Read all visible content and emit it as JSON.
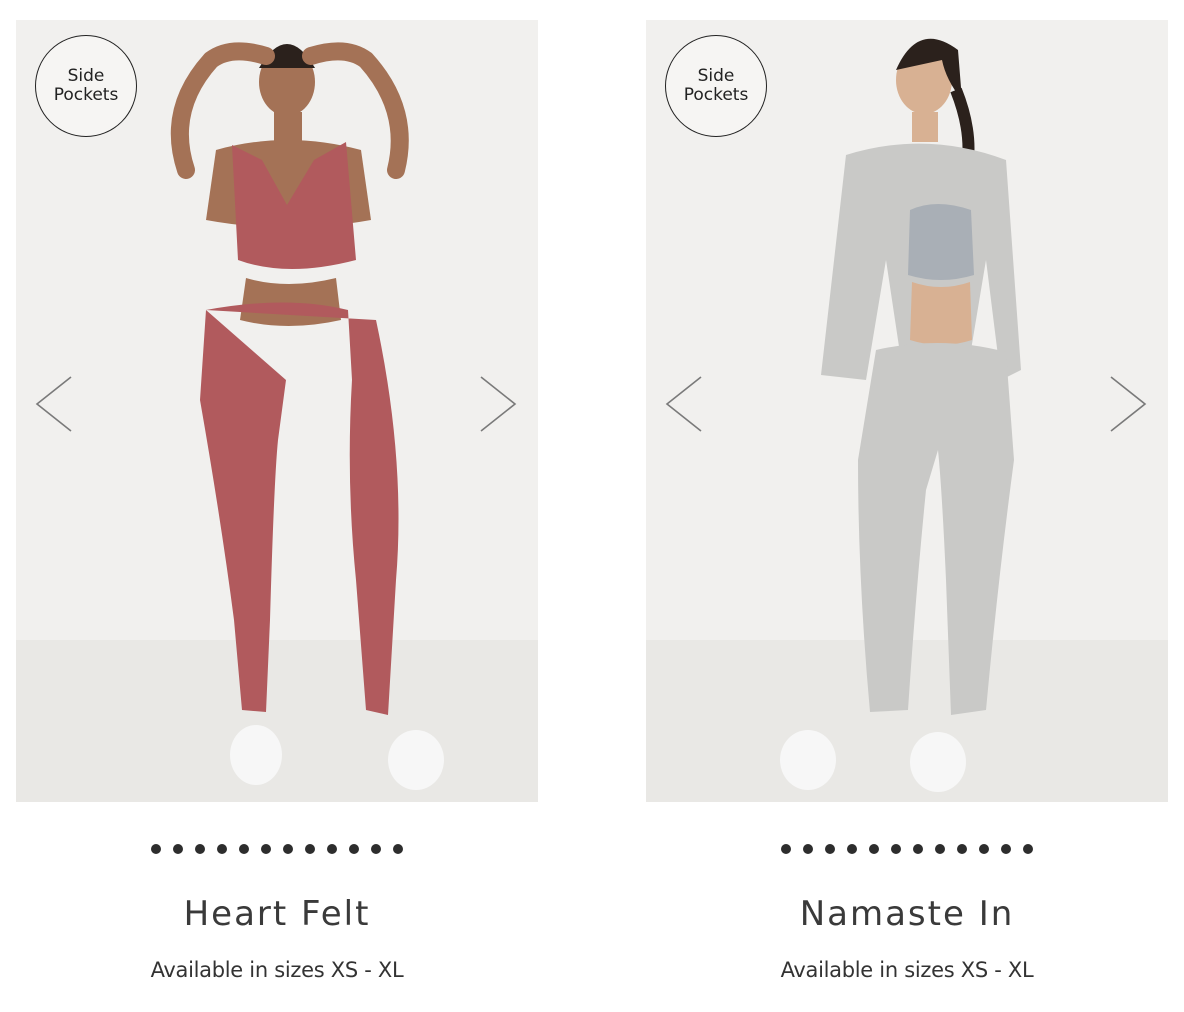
{
  "products": [
    {
      "badge_line1": "Side",
      "badge_line2": "Pockets",
      "title": "Heart Felt",
      "sizes_text": "Available in sizes XS - XL",
      "image_dots": 12,
      "outfit_color": "#b15a5d",
      "icons": {
        "prev": "chevron-left-icon",
        "next": "chevron-right-icon"
      }
    },
    {
      "badge_line1": "Side",
      "badge_line2": "Pockets",
      "title": "Namaste In",
      "sizes_text": "Available in sizes XS - XL",
      "image_dots": 12,
      "outfit_color": "#c9c9c7",
      "icons": {
        "prev": "chevron-left-icon",
        "next": "chevron-right-icon"
      }
    }
  ]
}
